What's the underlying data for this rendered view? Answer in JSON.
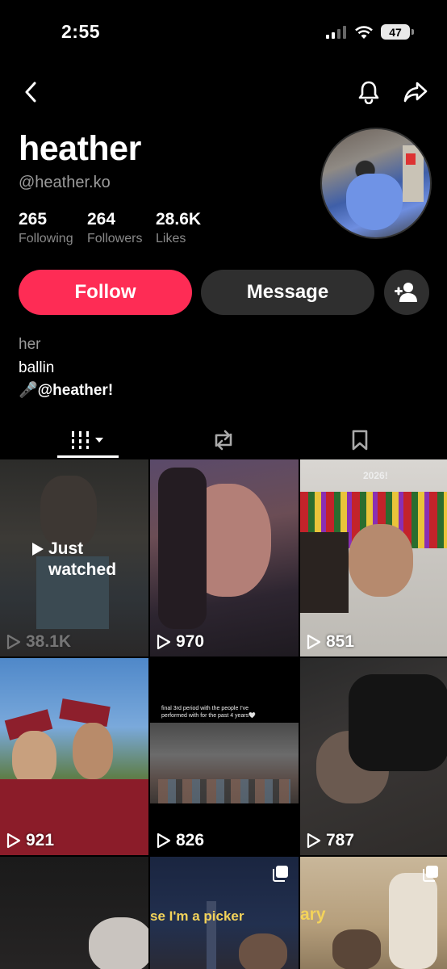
{
  "status": {
    "time": "2:55",
    "battery": "47"
  },
  "profile": {
    "display_name": "heather",
    "username": "@heather.ko",
    "stats": [
      {
        "value": "265",
        "label": "Following"
      },
      {
        "value": "264",
        "label": "Followers"
      },
      {
        "value": "28.6K",
        "label": "Likes"
      }
    ]
  },
  "actions": {
    "follow": "Follow",
    "message": "Message"
  },
  "bio": {
    "line1": "her",
    "line2": "ballin",
    "line3": "🎤@heather!"
  },
  "tabs": {
    "videos_icon": "grid-icon",
    "reposts_icon": "repost-icon",
    "saved_icon": "bookmark-icon"
  },
  "grid": {
    "just_watched_line1": "Just",
    "just_watched_line2": "watched",
    "tiles": [
      {
        "views": "38.1K"
      },
      {
        "views": "970"
      },
      {
        "views": "851",
        "caption": "2026!"
      },
      {
        "views": "921"
      },
      {
        "views": "826",
        "caption": "final 3rd period with the people I've performed with for the past 4 years🤍"
      },
      {
        "views": "787"
      },
      {
        "views": ""
      },
      {
        "views": "",
        "caption": "se I'm a picker"
      },
      {
        "views": "",
        "caption": "ary"
      }
    ]
  },
  "colors": {
    "accent": "#fe2c55",
    "secondary_button": "#2f2f2f",
    "muted_text": "#9b9b9b"
  }
}
